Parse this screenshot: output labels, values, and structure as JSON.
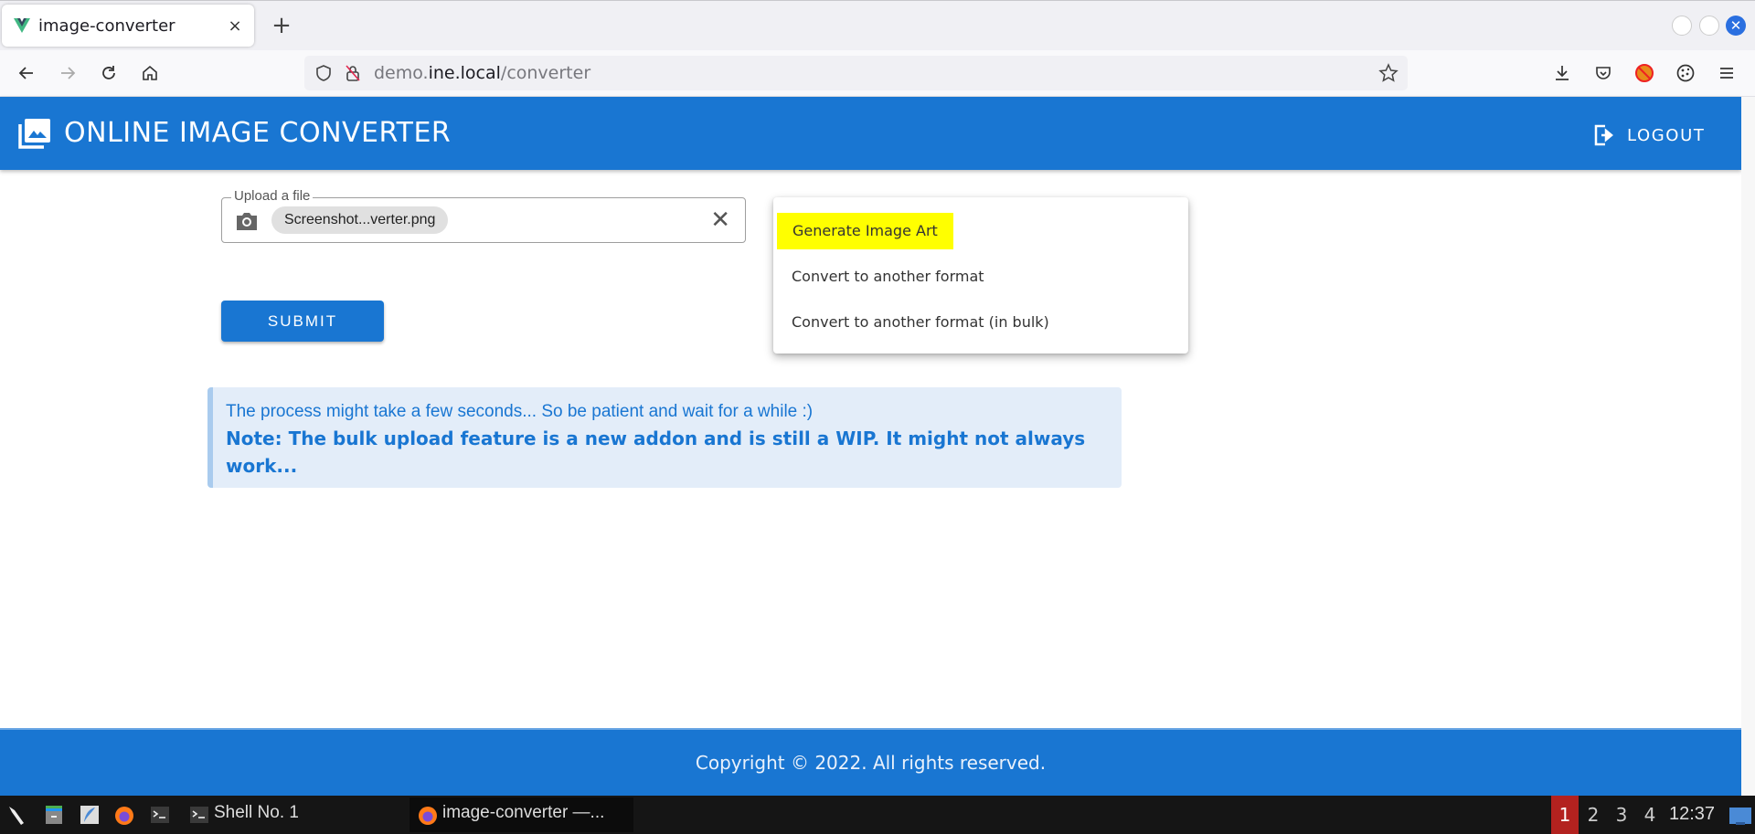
{
  "browser": {
    "tab": {
      "title": "image-converter",
      "close_label": "×"
    },
    "new_tab_label": "+",
    "url": {
      "prefix": "demo.",
      "domain": "ine.local",
      "path": "/converter"
    }
  },
  "app": {
    "title": "ONLINE IMAGE CONVERTER",
    "logout_label": "LOGOUT",
    "brand_color": "#1976d2"
  },
  "upload": {
    "label": "Upload a file",
    "file_chip": "Screenshot...verter.png",
    "clear_label": "✕"
  },
  "submit_label": "SUBMIT",
  "menu": {
    "items": [
      {
        "label": "Generate Image Art",
        "highlighted": true
      },
      {
        "label": "Convert to another format",
        "highlighted": false
      },
      {
        "label": "Convert to another format (in bulk)",
        "highlighted": false
      }
    ]
  },
  "alert": {
    "line1": "The process might take a few seconds... So be patient and wait for a while :)",
    "line2": "Note: The bulk upload feature is a new addon and is still a WIP. It might not always work..."
  },
  "footer": {
    "text": "Copyright © 2022. All rights reserved."
  },
  "taskbar": {
    "shell_label": "Shell No. 1",
    "window_label": "image-converter —...",
    "workspaces": [
      "1",
      "2",
      "3",
      "4"
    ],
    "active_workspace": "1",
    "clock": "12:37"
  }
}
